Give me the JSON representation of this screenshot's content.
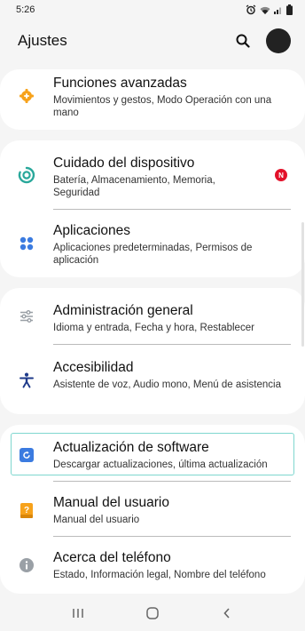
{
  "status_bar": {
    "time": "5:26"
  },
  "header": {
    "title": "Ajustes"
  },
  "colors": {
    "orange": "#f7a21b",
    "teal": "#2aa89b",
    "blue": "#3b7be0",
    "gray": "#9aa0a6",
    "navy": "#1e3a8a",
    "badge_red": "#e3112a"
  },
  "items": [
    {
      "title": "Funciones avanzadas",
      "subtitle": "Movimientos y gestos, Modo Operación con una mano",
      "icon": "gear-plus-icon"
    },
    {
      "title": "Cuidado del dispositivo",
      "subtitle": "Batería, Almacenamiento, Memoria, Seguridad",
      "icon": "device-care-icon",
      "badge": "N"
    },
    {
      "title": "Aplicaciones",
      "subtitle": "Aplicaciones predeterminadas, Permisos de aplicación",
      "icon": "apps-grid-icon"
    },
    {
      "title": "Administración general",
      "subtitle": "Idioma y entrada, Fecha y hora, Restablecer",
      "icon": "sliders-icon"
    },
    {
      "title": "Accesibilidad",
      "subtitle": "Asistente de voz, Audio mono, Menú de asistencia",
      "icon": "accessibility-icon"
    },
    {
      "title": "Actualización de software",
      "subtitle": "Descargar actualizaciones, última actualización",
      "icon": "software-update-icon"
    },
    {
      "title": "Manual del usuario",
      "subtitle": "Manual del usuario",
      "icon": "manual-icon"
    },
    {
      "title": "Acerca del teléfono",
      "subtitle": "Estado, Información legal, Nombre del teléfono",
      "icon": "info-icon"
    }
  ]
}
